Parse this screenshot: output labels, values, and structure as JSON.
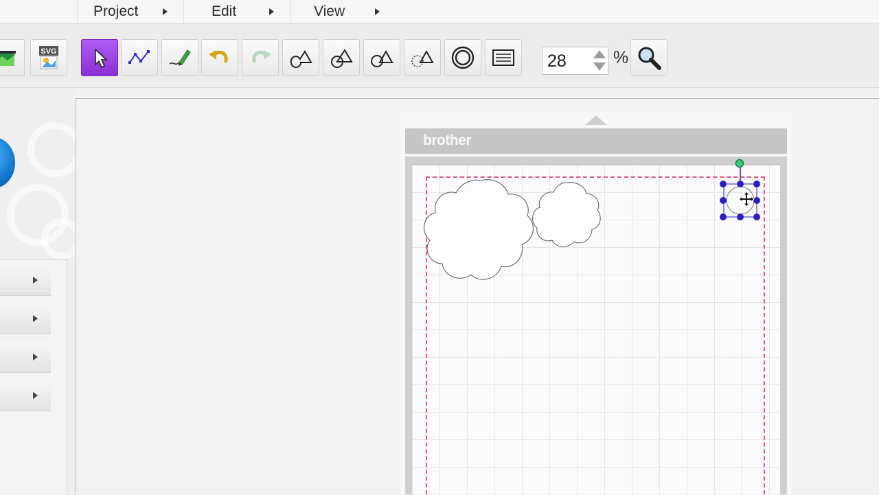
{
  "menubar": {
    "project_label": "Project",
    "edit_label": "Edit",
    "view_label": "View"
  },
  "toolbar": {
    "tools": [
      {
        "name": "image-trace-icon"
      },
      {
        "name": "svg-import-icon",
        "label": "SVG"
      },
      {
        "name": "select-arrow-icon",
        "active": true
      },
      {
        "name": "point-edit-icon"
      },
      {
        "name": "draw-pen-icon"
      },
      {
        "name": "undo-icon"
      },
      {
        "name": "redo-icon",
        "disabled": true
      },
      {
        "name": "weld-icon"
      },
      {
        "name": "combine-icon"
      },
      {
        "name": "group-icon"
      },
      {
        "name": "ungroup-icon"
      },
      {
        "name": "offset-icon"
      },
      {
        "name": "properties-icon"
      },
      {
        "name": "zoom-magnifier-icon"
      }
    ],
    "zoom_value": "28",
    "zoom_unit": "%"
  },
  "mat": {
    "brand": "brother"
  },
  "colors": {
    "active_tool": "#9a3ee6",
    "selection_handles": "#2a1fc4",
    "rotate_handle": "#37d07a",
    "cut_area_border": "#e6527a",
    "mat_frame": "#c6c6c6"
  }
}
